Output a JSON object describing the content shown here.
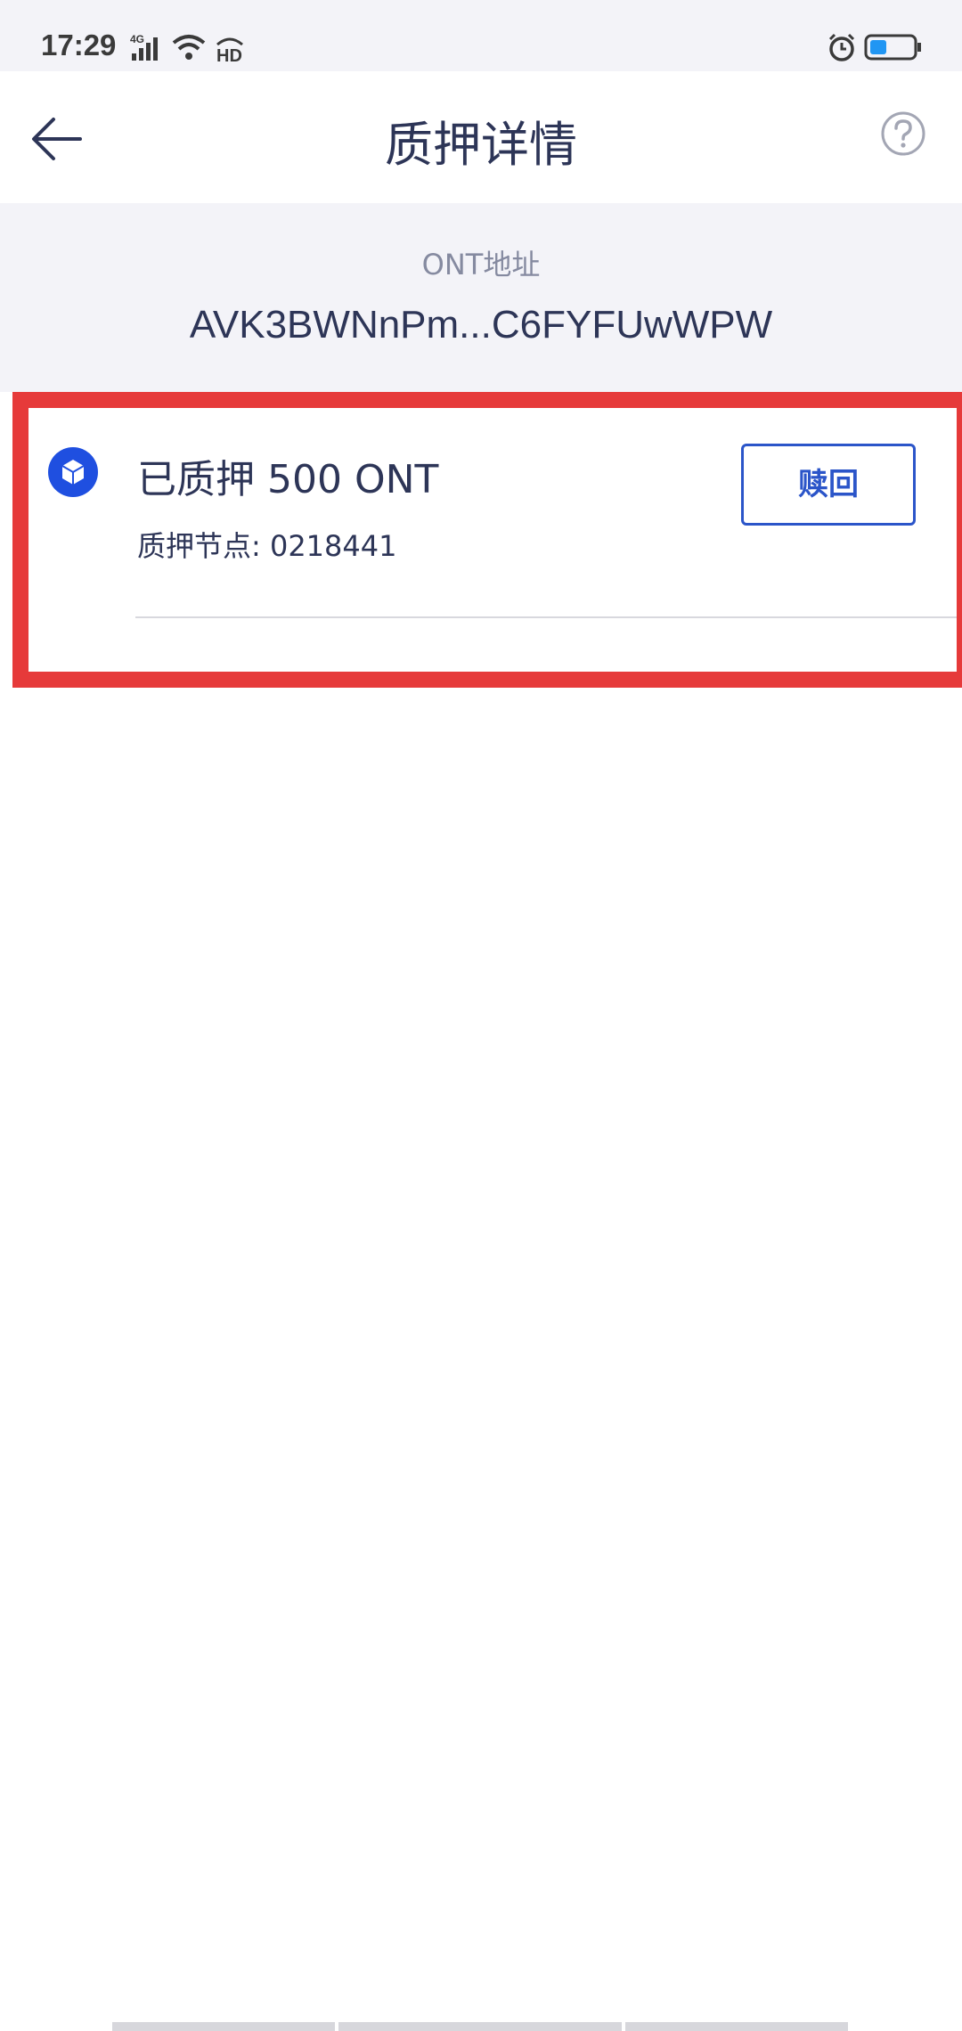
{
  "status_bar": {
    "time": "17:29",
    "network": "4G",
    "hd_badge": "HD"
  },
  "header": {
    "title": "质押详情",
    "back_icon": "arrow-left-icon",
    "help_icon": "question-circle-icon"
  },
  "address": {
    "label": "ONT地址",
    "value": "AVK3BWNnPm...C6FYFUwWPW"
  },
  "stake_item": {
    "title": "已质押 500 ONT",
    "node": "质押节点: 0218441",
    "redeem_label": "赎回",
    "icon": "cube-icon"
  },
  "colors": {
    "accent": "#2b55c9",
    "highlight": "#e63a3a",
    "text": "#2d3557",
    "muted": "#858aa0",
    "section_bg": "#f3f3f8"
  }
}
